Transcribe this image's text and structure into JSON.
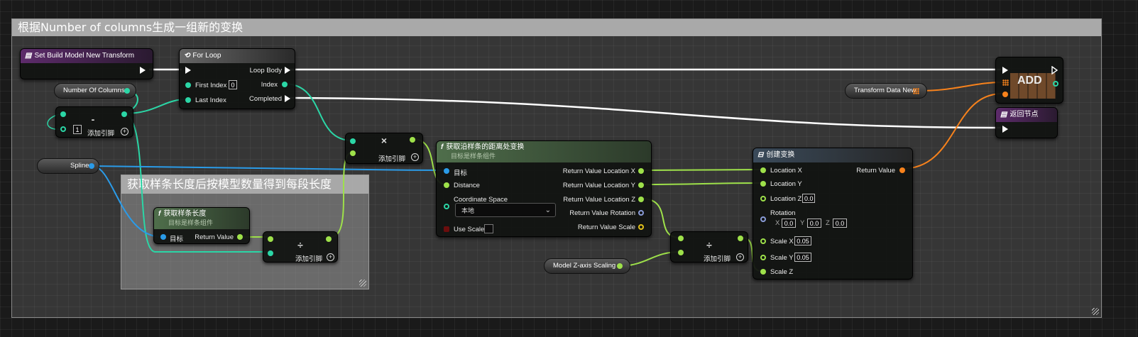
{
  "colors": {
    "wire_exec": "#ffffff",
    "wire_float": "#9ee14a",
    "wire_int": "#2bd6a6",
    "wire_object": "#2a9be8",
    "wire_struct": "#f7821c",
    "comment_header": "#a9a9a9"
  },
  "comments": {
    "main": "根据Number of columns生成一组新的变换",
    "sub": "获取样条长度后按模型数量得到每段长度"
  },
  "set_transform": {
    "title": "Set Build Model New Transform",
    "icon": "variable-set-icon"
  },
  "for_loop": {
    "title": "For Loop",
    "icon": "loop-icon",
    "first_index_label": "First Index",
    "first_index_value": "0",
    "last_index_label": "Last Index",
    "loop_body_label": "Loop Body",
    "index_label": "Index",
    "completed_label": "Completed"
  },
  "number_of_columns": {
    "label": "Number Of Columns"
  },
  "subtract_node": {
    "symbol": "-",
    "value": "1",
    "add_pin_label": "添加引脚"
  },
  "spline": {
    "label": "Spline"
  },
  "get_spline_length": {
    "title": "获取样条长度",
    "subtitle": "目标是样条组件",
    "target_label": "目标",
    "return_label": "Return Value"
  },
  "divide_node_1": {
    "symbol": "÷",
    "add_pin_label": "添加引脚"
  },
  "multiply_node": {
    "symbol": "×",
    "add_pin_label": "添加引脚"
  },
  "get_transform_at_distance": {
    "title": "获取沿样条的距离处变换",
    "subtitle": "目标是样条组件",
    "target_label": "目标",
    "distance_label": "Distance",
    "coord_space_label": "Coordinate Space",
    "coord_space_value": "本地",
    "use_scale_label": "Use Scale",
    "out_x": "Return Value Location X",
    "out_y": "Return Value Location Y",
    "out_z": "Return Value Location Z",
    "out_rot": "Return Value Rotation",
    "out_scale": "Return Value Scale"
  },
  "model_z_scaling": {
    "label": "Model Z-axis Scaling"
  },
  "divide_node_2": {
    "symbol": "÷",
    "add_pin_label": "添加引脚"
  },
  "make_transform": {
    "title": "创建变换",
    "location_x": "Location X",
    "location_y": "Location Y",
    "location_z": "Location Z",
    "location_z_value": "0.0",
    "rotation": "Rotation",
    "rot_x_label": "X",
    "rot_x": "0.0",
    "rot_y_label": "Y",
    "rot_y": "0.0",
    "rot_z_label": "Z",
    "rot_z": "0.0",
    "scale_x": "Scale X",
    "scale_x_value": "0.05",
    "scale_y": "Scale Y",
    "scale_y_value": "0.05",
    "scale_z": "Scale Z",
    "return_label": "Return Value"
  },
  "transform_data_new": {
    "label": "Transform Data New"
  },
  "add_node": {
    "label": "ADD"
  },
  "return_node": {
    "title": "返回节点"
  }
}
